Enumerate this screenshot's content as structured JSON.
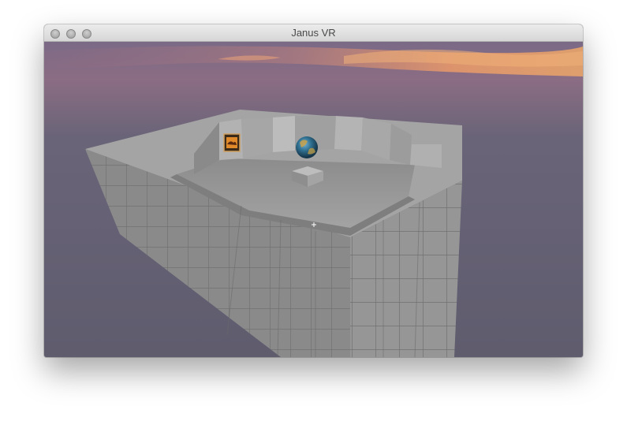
{
  "window": {
    "title": "Janus VR"
  },
  "scene": {
    "sky_color": "#5f5c6e",
    "sunset_colors": [
      "#e8a46a",
      "#d47a72",
      "#8e6a84"
    ],
    "wall_color": "#8f8f8f",
    "floor_color": "#9a9a9a",
    "objects": [
      "stone-block-room",
      "globe",
      "painting",
      "pedestal-box",
      "crosshair"
    ]
  }
}
